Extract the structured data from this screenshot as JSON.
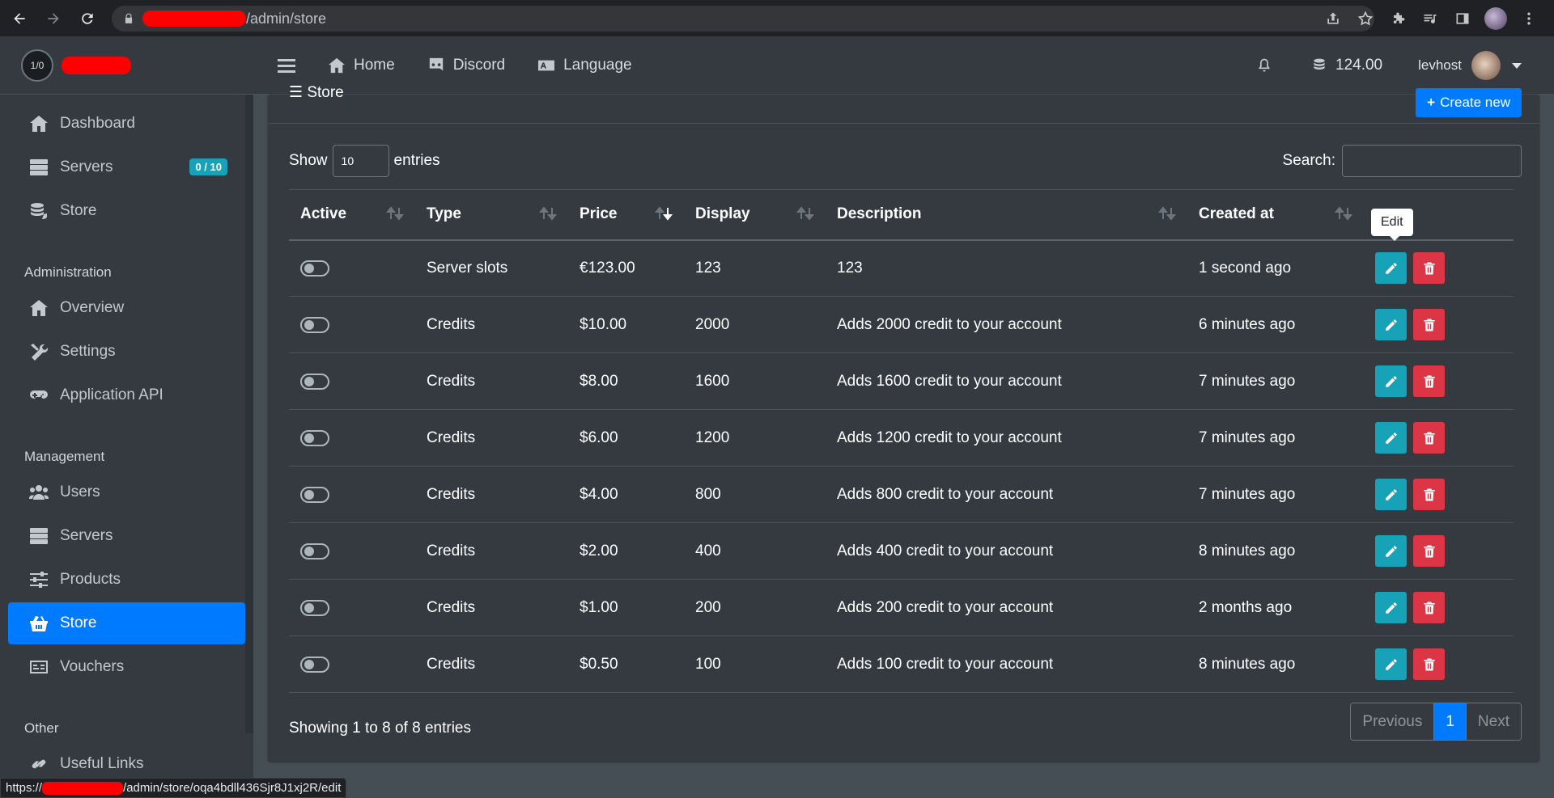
{
  "browser": {
    "url_suffix": "/admin/store",
    "status_url_prefix": "https://",
    "status_url_suffix": "/admin/store/oqa4bdll436Sjr8J1xj2R/edit"
  },
  "sidebar": {
    "logo_text": "1/0",
    "items_main": [
      {
        "label": "Dashboard",
        "icon": "home-icon"
      },
      {
        "label": "Servers",
        "icon": "server-icon",
        "badge": "0 / 10"
      },
      {
        "label": "Store",
        "icon": "coins-icon"
      }
    ],
    "admin_header": "Administration",
    "items_admin": [
      {
        "label": "Overview",
        "icon": "home-icon"
      },
      {
        "label": "Settings",
        "icon": "tools-icon"
      },
      {
        "label": "Application API",
        "icon": "gamepad-icon"
      }
    ],
    "management_header": "Management",
    "items_management": [
      {
        "label": "Users",
        "icon": "users-icon"
      },
      {
        "label": "Servers",
        "icon": "server-icon"
      },
      {
        "label": "Products",
        "icon": "sliders-icon"
      },
      {
        "label": "Store",
        "icon": "basket-icon",
        "active": true
      },
      {
        "label": "Vouchers",
        "icon": "money-check-icon"
      }
    ],
    "other_header": "Other",
    "items_other": [
      {
        "label": "Useful Links",
        "icon": "link-icon"
      }
    ]
  },
  "topnav": {
    "home": "Home",
    "discord": "Discord",
    "language": "Language",
    "credits": "124.00",
    "username": "levhost"
  },
  "card": {
    "title": "Store",
    "create_button": "Create new",
    "show_label": "Show",
    "entries_value": "10",
    "entries_label": "entries",
    "search_label": "Search:",
    "columns": [
      "Active",
      "Type",
      "Price",
      "Display",
      "Description",
      "Created at"
    ],
    "tooltip": "Edit",
    "rows": [
      {
        "type": "Server slots",
        "price": "€123.00",
        "display": "123",
        "description": "123",
        "created": "1 second ago"
      },
      {
        "type": "Credits",
        "price": "$10.00",
        "display": "2000",
        "description": "Adds 2000 credit to your account",
        "created": "6 minutes ago"
      },
      {
        "type": "Credits",
        "price": "$8.00",
        "display": "1600",
        "description": "Adds 1600 credit to your account",
        "created": "7 minutes ago"
      },
      {
        "type": "Credits",
        "price": "$6.00",
        "display": "1200",
        "description": "Adds 1200 credit to your account",
        "created": "7 minutes ago"
      },
      {
        "type": "Credits",
        "price": "$4.00",
        "display": "800",
        "description": "Adds 800 credit to your account",
        "created": "7 minutes ago"
      },
      {
        "type": "Credits",
        "price": "$2.00",
        "display": "400",
        "description": "Adds 400 credit to your account",
        "created": "8 minutes ago"
      },
      {
        "type": "Credits",
        "price": "$1.00",
        "display": "200",
        "description": "Adds 200 credit to your account",
        "created": "2 months ago"
      },
      {
        "type": "Credits",
        "price": "$0.50",
        "display": "100",
        "description": "Adds 100 credit to your account",
        "created": "8 minutes ago"
      }
    ],
    "info": "Showing 1 to 8 of 8 entries",
    "pager": {
      "previous": "Previous",
      "page": "1",
      "next": "Next"
    }
  }
}
